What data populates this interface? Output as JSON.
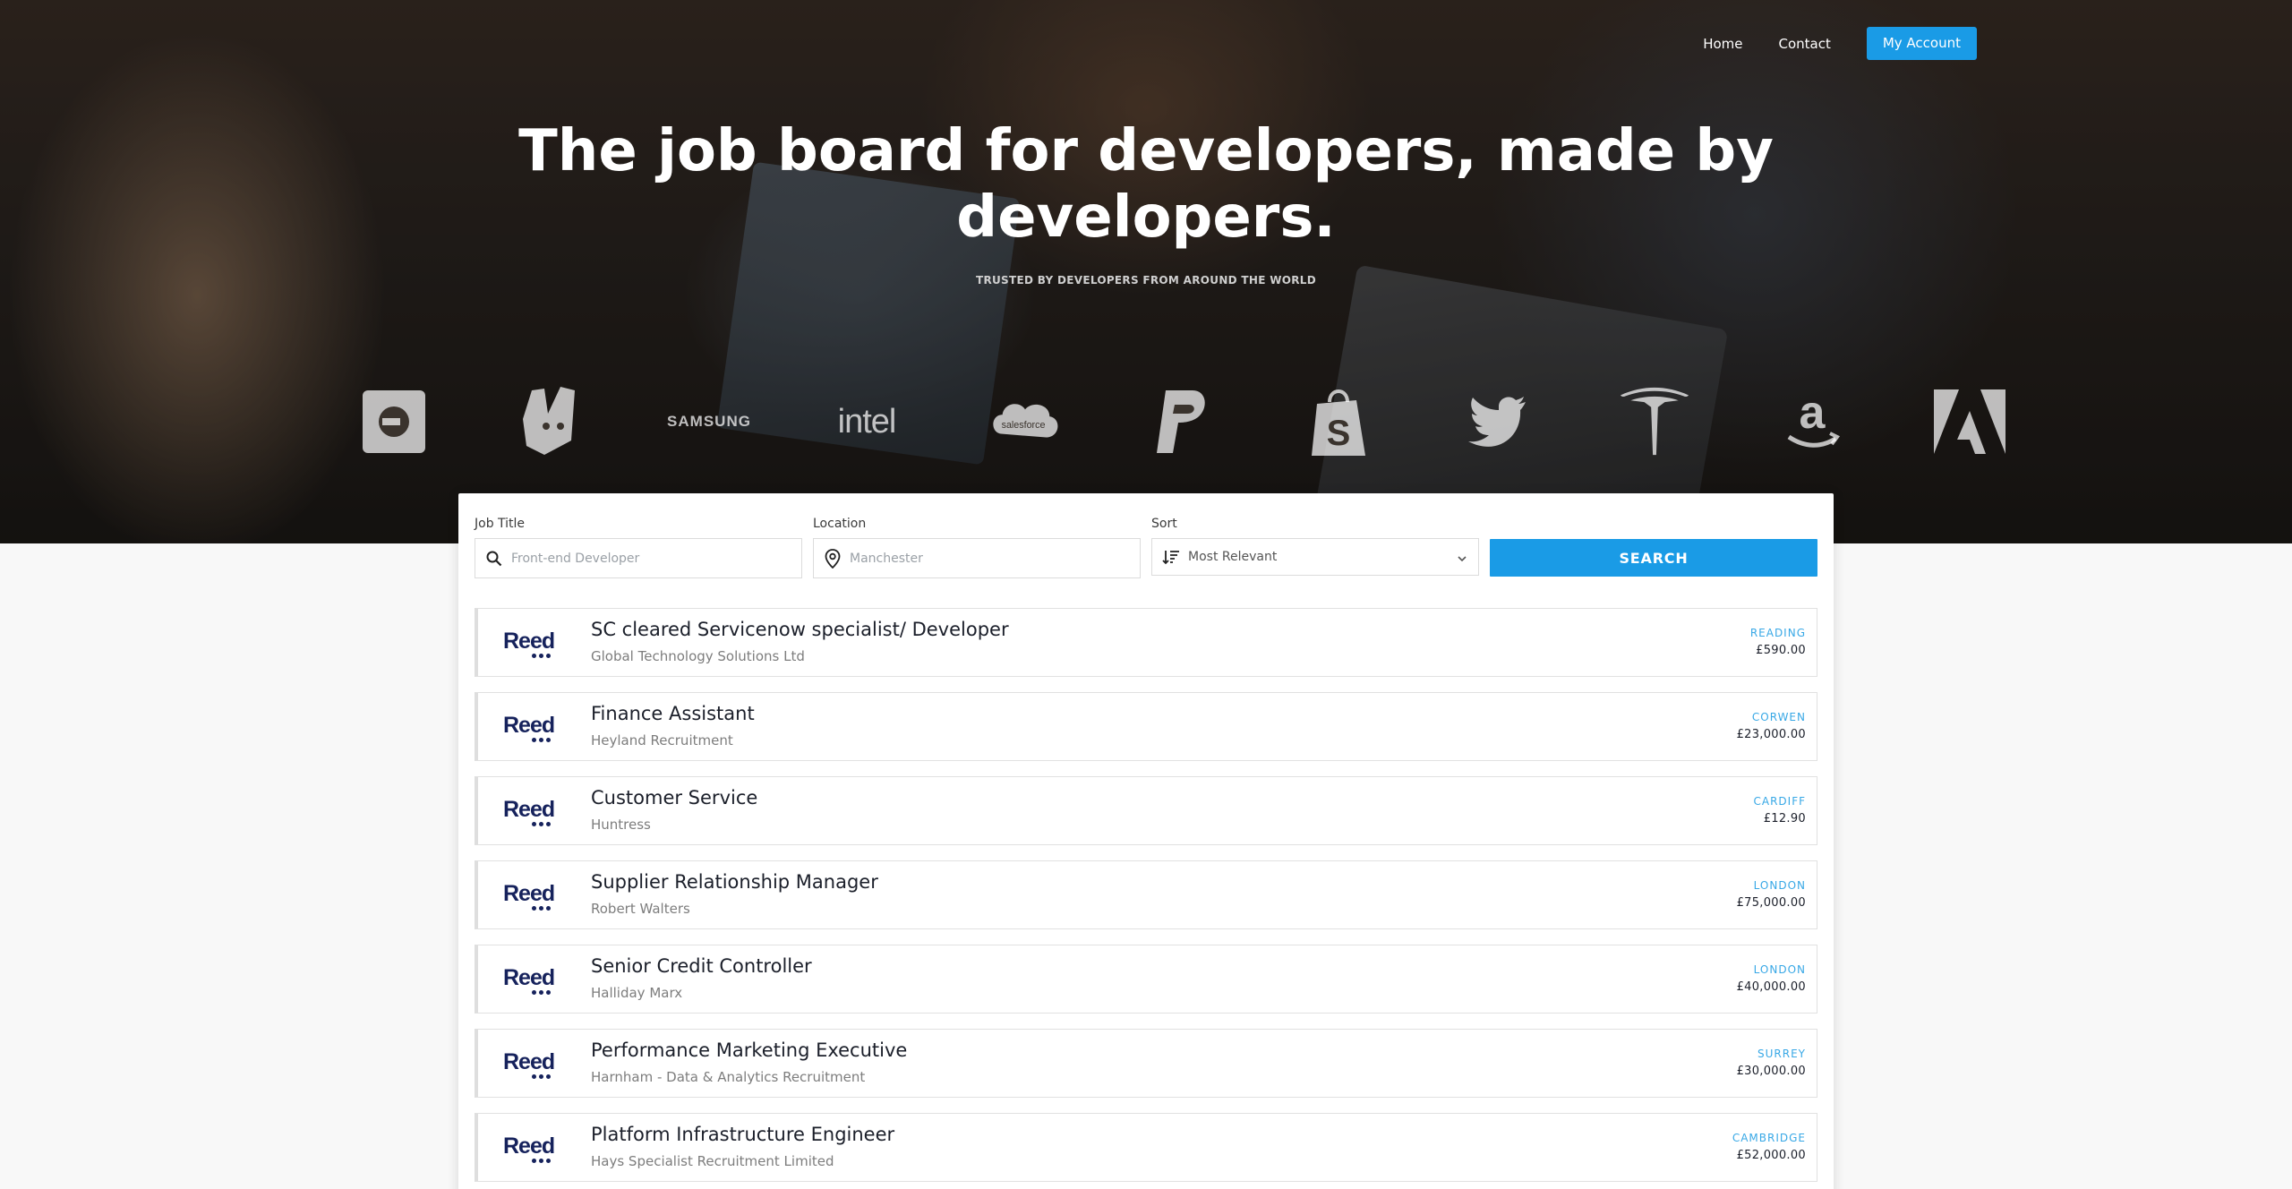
{
  "nav": {
    "home": "Home",
    "contact": "Contact",
    "account": "My Account"
  },
  "hero": {
    "title_line1": "The job board for developers, made by",
    "title_line2": "developers.",
    "subtitle": "TRUSTED BY DEVELOPERS FROM AROUND THE WORLD",
    "logos": [
      "uber",
      "deliveroo",
      "SAMSUNG",
      "intel",
      "salesforce",
      "paypal",
      "shopify",
      "twitter",
      "tesla",
      "amazon",
      "adobe"
    ]
  },
  "search": {
    "job_title_label": "Job Title",
    "job_title_placeholder": "Front-end Developer",
    "location_label": "Location",
    "location_placeholder": "Manchester",
    "sort_label": "Sort",
    "sort_value": "Most Relevant",
    "button": "SEARCH"
  },
  "jobs": [
    {
      "logo": "Reed",
      "title": "SC cleared Servicenow specialist/ Developer",
      "company": "Global Technology Solutions Ltd",
      "location": "READING",
      "salary": "£590.00"
    },
    {
      "logo": "Reed",
      "title": "Finance Assistant",
      "company": "Heyland Recruitment",
      "location": "CORWEN",
      "salary": "£23,000.00"
    },
    {
      "logo": "Reed",
      "title": "Customer Service",
      "company": "Huntress",
      "location": "CARDIFF",
      "salary": "£12.90"
    },
    {
      "logo": "Reed",
      "title": "Supplier Relationship Manager",
      "company": "Robert Walters",
      "location": "LONDON",
      "salary": "£75,000.00"
    },
    {
      "logo": "Reed",
      "title": "Senior Credit Controller",
      "company": "Halliday Marx",
      "location": "LONDON",
      "salary": "£40,000.00"
    },
    {
      "logo": "Reed",
      "title": "Performance Marketing Executive",
      "company": "Harnham - Data & Analytics Recruitment",
      "location": "SURREY",
      "salary": "£30,000.00"
    },
    {
      "logo": "Reed",
      "title": "Platform Infrastructure Engineer",
      "company": "Hays Specialist Recruitment Limited",
      "location": "CAMBRIDGE",
      "salary": "£52,000.00"
    }
  ],
  "colors": {
    "accent": "#1a9be6",
    "location": "#38a8e6",
    "reed": "#16225c"
  }
}
